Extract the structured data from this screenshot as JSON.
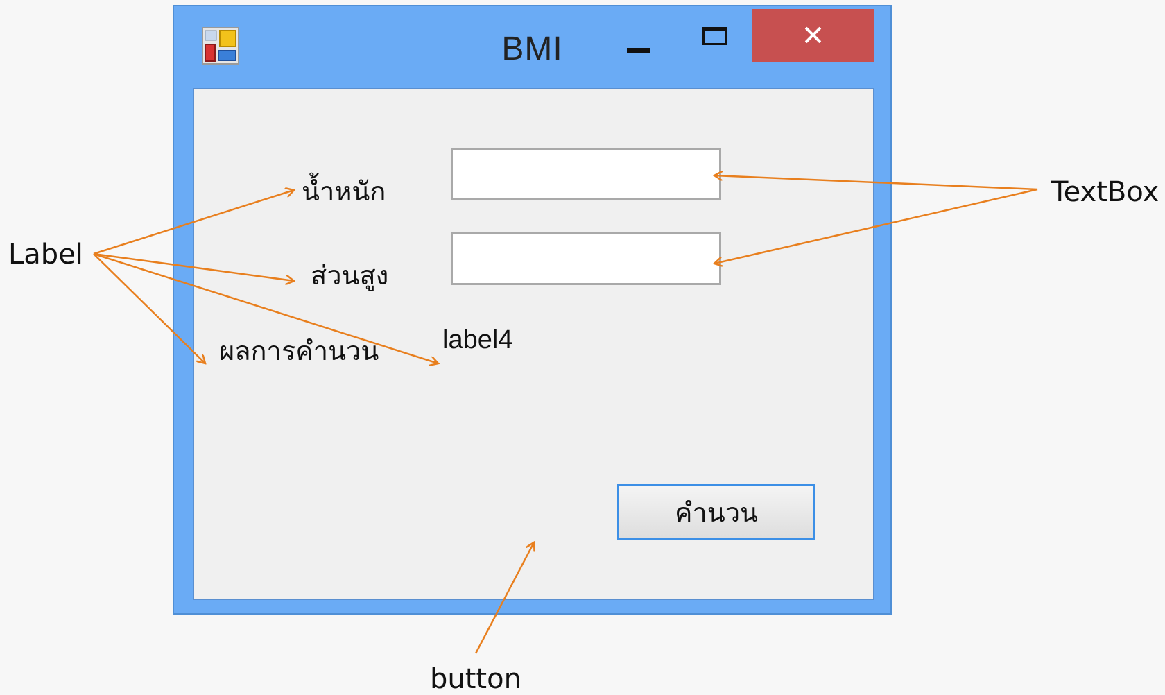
{
  "window": {
    "title": "BMI",
    "close_glyph": "✕",
    "minimize_icon": "minimize-icon",
    "maximize_icon": "maximize-icon",
    "app_icon": "app-form-icon"
  },
  "form": {
    "weight_label": "น้ำหนัก",
    "height_label": "ส่วนสูง",
    "result_label": "ผลการคำนวน",
    "result_value": "label4",
    "weight_value": "",
    "height_value": "",
    "calculate_button": "คำนวน"
  },
  "annotations": {
    "label": "Label",
    "textbox": "TextBox",
    "button": "button"
  },
  "colors": {
    "window_frame": "#6aabf5",
    "close_button": "#c75050",
    "client_area": "#f0f0f0",
    "arrow": "#e87f1e",
    "button_border": "#3c8fe6"
  }
}
